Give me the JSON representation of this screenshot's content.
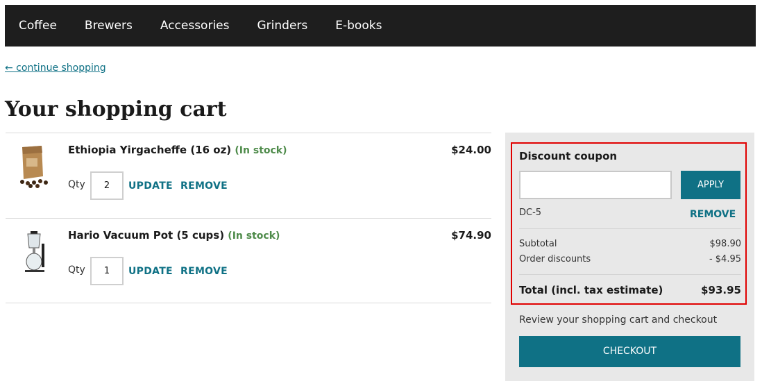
{
  "nav": {
    "items": [
      "Coffee",
      "Brewers",
      "Accessories",
      "Grinders",
      "E-books"
    ]
  },
  "continue_link": "← continue shopping",
  "page_title": "Your shopping cart",
  "cart": {
    "qty_label": "Qty",
    "update_label": "UPDATE",
    "remove_label": "REMOVE",
    "items": [
      {
        "name": "Ethiopia Yirgacheffe (16 oz)",
        "stock": "(In stock)",
        "price": "$24.00",
        "qty": "2",
        "icon": "coffee-bag-icon"
      },
      {
        "name": "Hario Vacuum Pot (5 cups)",
        "stock": "(In stock)",
        "price": "$74.90",
        "qty": "1",
        "icon": "vacuum-pot-icon"
      }
    ]
  },
  "summary": {
    "coupon_title": "Discount coupon",
    "coupon_input_value": "",
    "apply_label": "APPLY",
    "applied_code": "DC-5",
    "coupon_remove_label": "REMOVE",
    "subtotal_label": "Subtotal",
    "subtotal_value": "$98.90",
    "discount_label": "Order discounts",
    "discount_value": "- $4.95",
    "total_label": "Total (incl. tax estimate)",
    "total_value": "$93.95",
    "review_text": "Review your shopping cart and checkout",
    "checkout_label": "CHECKOUT"
  },
  "colors": {
    "accent": "#0f7185",
    "nav_bg": "#1e1e1e",
    "in_stock": "#4e8b4a",
    "highlight_border": "#e00000"
  }
}
